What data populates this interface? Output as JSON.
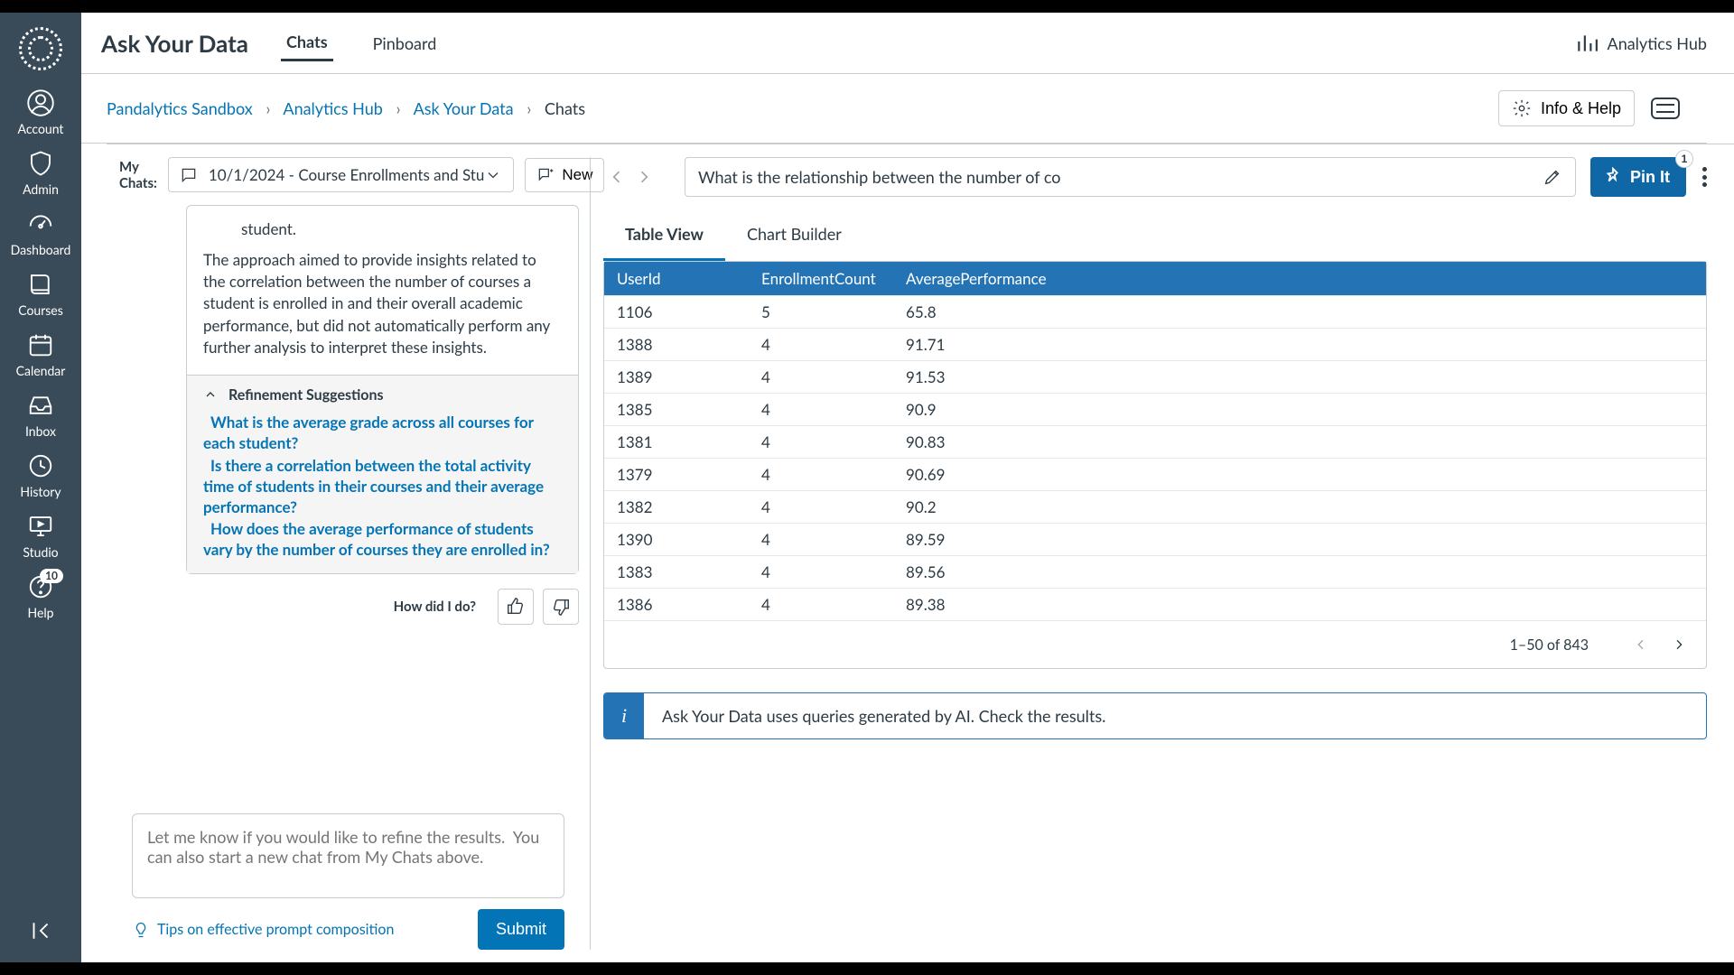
{
  "nav": {
    "account": "Account",
    "admin": "Admin",
    "dashboard": "Dashboard",
    "courses": "Courses",
    "calendar": "Calendar",
    "inbox": "Inbox",
    "history": "History",
    "studio": "Studio",
    "help": "Help",
    "help_badge": "10"
  },
  "header": {
    "title": "Ask Your Data",
    "tab_chats": "Chats",
    "tab_pinboard": "Pinboard",
    "hub": "Analytics Hub"
  },
  "crumbs": {
    "a": "Pandalytics Sandbox",
    "b": "Analytics Hub",
    "c": "Ask Your Data",
    "d": "Chats",
    "info_help": "Info & Help"
  },
  "lpane": {
    "mychats_label": "My Chats:",
    "selected_chat": "10/1/2024 - Course Enrollments and Stu",
    "new_btn": "New",
    "answer_bullet": "student.",
    "answer_para": "The approach aimed to provide insights related to the correlation between the number of courses a student is enrolled in and their overall academic performance, but did not automatically perform any further analysis to interpret these insights.",
    "refine_hd": "Refinement Suggestions",
    "sugg1": "What is the average grade across all courses for each student?",
    "sugg2": "Is there a correlation between the total activity time of students in their courses and their average performance?",
    "sugg3": "How does the average performance of students vary by the number of courses they are enrolled in?",
    "feedback_q": "How did I do?",
    "compose_placeholder": "Let me know if you would like to refine the results.  You can also start a new chat from My Chats above.",
    "tips": "Tips on effective prompt composition",
    "submit": "Submit"
  },
  "rpane": {
    "query": "What is the relationship between the number of co",
    "pin_label": "Pin It",
    "pin_count": "1",
    "tab_table": "Table View",
    "tab_chart": "Chart Builder",
    "cols": {
      "c1": "UserId",
      "c2": "EnrollmentCount",
      "c3": "AveragePerformance"
    },
    "rows": [
      {
        "c1": "1106",
        "c2": "5",
        "c3": "65.8"
      },
      {
        "c1": "1388",
        "c2": "4",
        "c3": "91.71"
      },
      {
        "c1": "1389",
        "c2": "4",
        "c3": "91.53"
      },
      {
        "c1": "1385",
        "c2": "4",
        "c3": "90.9"
      },
      {
        "c1": "1381",
        "c2": "4",
        "c3": "90.83"
      },
      {
        "c1": "1379",
        "c2": "4",
        "c3": "90.69"
      },
      {
        "c1": "1382",
        "c2": "4",
        "c3": "90.2"
      },
      {
        "c1": "1390",
        "c2": "4",
        "c3": "89.59"
      },
      {
        "c1": "1383",
        "c2": "4",
        "c3": "89.56"
      },
      {
        "c1": "1386",
        "c2": "4",
        "c3": "89.38"
      }
    ],
    "pager": "1–50 of 843",
    "notice": "Ask Your Data uses queries generated by AI. Check the results."
  }
}
